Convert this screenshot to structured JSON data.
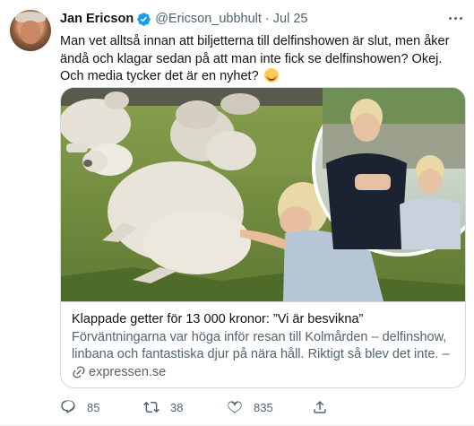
{
  "tweet": {
    "author_name": "Jan Ericson",
    "handle": "@Ericson_ubbhult",
    "separator": "·",
    "time": "Jul 25",
    "text": "Man vet alltså innan att biljetterna till delfinshowen är slut, men åker ändå och klagar sedan på att man inte fick se delfinshowen? Okej. Och media tycker det är en nyhet?",
    "emoji": "smiling-face-with-smiling-eyes-emoji"
  },
  "card": {
    "title": "Klappade getter för 13 000 kronor: ”Vi är besvikna”",
    "description": "Förväntningarna var höga inför resan till Kolmården – delfinshow, linbana och fantastiska djur på nära håll. Riktigt så blev det inte. – Vi ...",
    "domain": "expressen.se"
  },
  "actions": {
    "reply_count": "85",
    "retweet_count": "38",
    "like_count": "835"
  },
  "colors": {
    "accent": "#1d9bf0",
    "text_primary": "#0f1419",
    "text_secondary": "#536471",
    "border": "#cfd9de"
  },
  "icons": [
    "verified-badge-icon",
    "more-options-icon",
    "link-icon",
    "reply-icon",
    "retweet-icon",
    "like-icon",
    "share-icon"
  ]
}
